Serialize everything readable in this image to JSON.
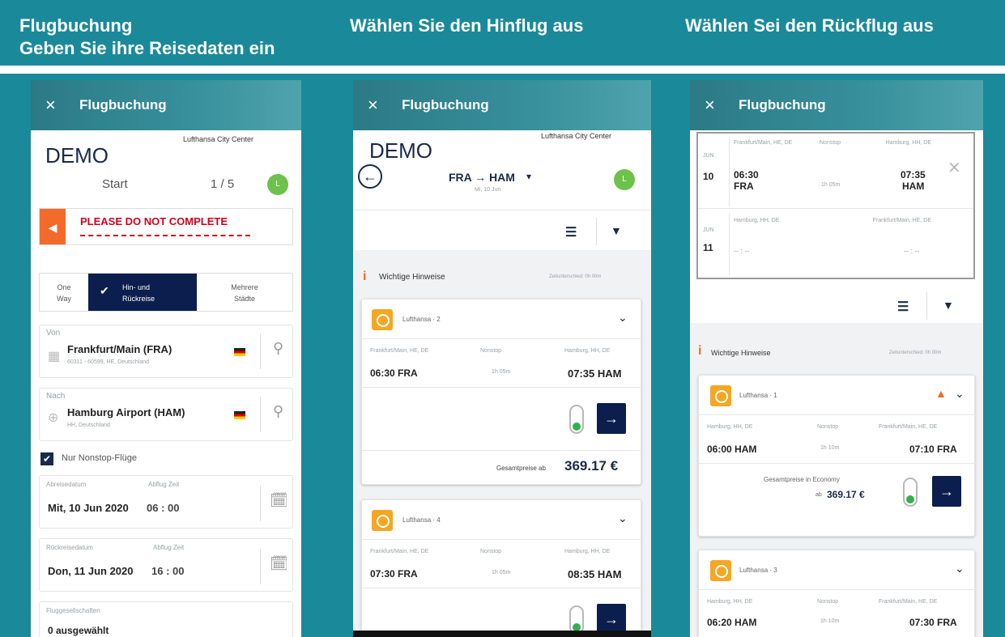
{
  "headers": {
    "col1_line1": "Flugbuchung",
    "col1_line2": "Geben Sie ihre Reisedaten ein",
    "col2": "Wählen Sie den Hinflug aus",
    "col3": "Wählen Sei den Rückflug aus"
  },
  "app": {
    "title": "Flugbuchung",
    "close": "×",
    "brand": "Lufthansa City Center",
    "brand_mark": "DEMO"
  },
  "colors": {
    "teal": "#1a8a9a",
    "navy": "#0b1e4d",
    "orange": "#f5a623",
    "green": "#6cc24a",
    "red": "#d0021b"
  },
  "screen1": {
    "step_label": "Start",
    "step_counter": "1 / 5",
    "warning": "PLEASE DO NOT COMPLETE",
    "trip_types": {
      "one_way_1": "One",
      "one_way_2": "Way",
      "round_1": "Hin- und",
      "round_2": "Rückreise",
      "multi_1": "Mehrere",
      "multi_2": "Städte"
    },
    "from_label": "Von",
    "from_value": "Frankfurt/Main (FRA)",
    "from_sub": "60311 - 60599, HE, Deutschland",
    "to_label": "Nach",
    "to_value": "Hamburg Airport (HAM)",
    "to_sub": "HH, Deutschland",
    "nonstop": "Nur Nonstop-Flüge",
    "depart_date_label": "Abreisedatum",
    "depart_time_label": "Abflug Zeit",
    "depart_date": "Mit, 10 Jun 2020",
    "depart_time": "06 : 00",
    "return_date_label": "Rückreisedatum",
    "return_time_label": "Abflug Zeit",
    "return_date": "Don, 11 Jun 2020",
    "return_time": "16 : 00",
    "airline_label": "Fluggesellschaften",
    "airline_value": "0 ausgewählt"
  },
  "screen2": {
    "route": "FRA → HAM",
    "date": "Mi, 10 Jun",
    "notice": "Wichtige Hinweise",
    "notice_right": "Zeitunterschied: 0h 00m",
    "price_label": "Gesamtpreise ab",
    "price": "369.17 €",
    "flights": [
      {
        "airline": "Lufthansa · 2",
        "from_city": "Frankfurt/Main, HE, DE",
        "stop": "Nonstop",
        "to_city": "Hamburg, HH, DE",
        "dep": "06:30 FRA",
        "dur": "1h 05m",
        "arr": "07:35 HAM"
      },
      {
        "airline": "Lufthansa · 4",
        "from_city": "Frankfurt/Main, HE, DE",
        "stop": "Nonstop",
        "to_city": "Hamburg, HH, DE",
        "dep": "07:30 FRA",
        "dur": "1h 05m",
        "arr": "08:35 HAM"
      }
    ]
  },
  "screen3": {
    "summary": {
      "out_month": "JUN",
      "out_day": "10",
      "out_from": "Frankfurt/Main, HE, DE",
      "out_stop": "Nonstop",
      "out_to": "Hamburg, HH, DE",
      "out_dep": "06:30",
      "out_dep_code": "FRA",
      "out_dur": "1h 05m",
      "out_arr": "07:35",
      "out_arr_code": "HAM",
      "ret_month": "JUN",
      "ret_day": "11",
      "ret_from": "Hamburg, HH, DE",
      "ret_to": "Frankfurt/Main, HE, DE",
      "ret_dep": "-- : --",
      "ret_arr": "-- : --"
    },
    "notice": "Wichtige Hinweise",
    "notice_right": "Zeitunterschied: 0h 00m",
    "price_label": "Gesamtpreise in Economy",
    "price_prefix": "ab",
    "price": "369.17 €",
    "flights": [
      {
        "airline": "Lufthansa · 1",
        "from_city": "Hamburg, HH, DE",
        "stop": "Nonstop",
        "to_city": "Frankfurt/Main, HE, DE",
        "dep": "06:00 HAM",
        "dur": "1h 10m",
        "arr": "07:10 FRA"
      },
      {
        "airline": "Lufthansa · 3",
        "from_city": "Hamburg, HH, DE",
        "stop": "Nonstop",
        "to_city": "Frankfurt/Main, HE, DE",
        "dep": "06:20 HAM",
        "dur": "1h 10m",
        "arr": "07:30 FRA"
      }
    ]
  }
}
